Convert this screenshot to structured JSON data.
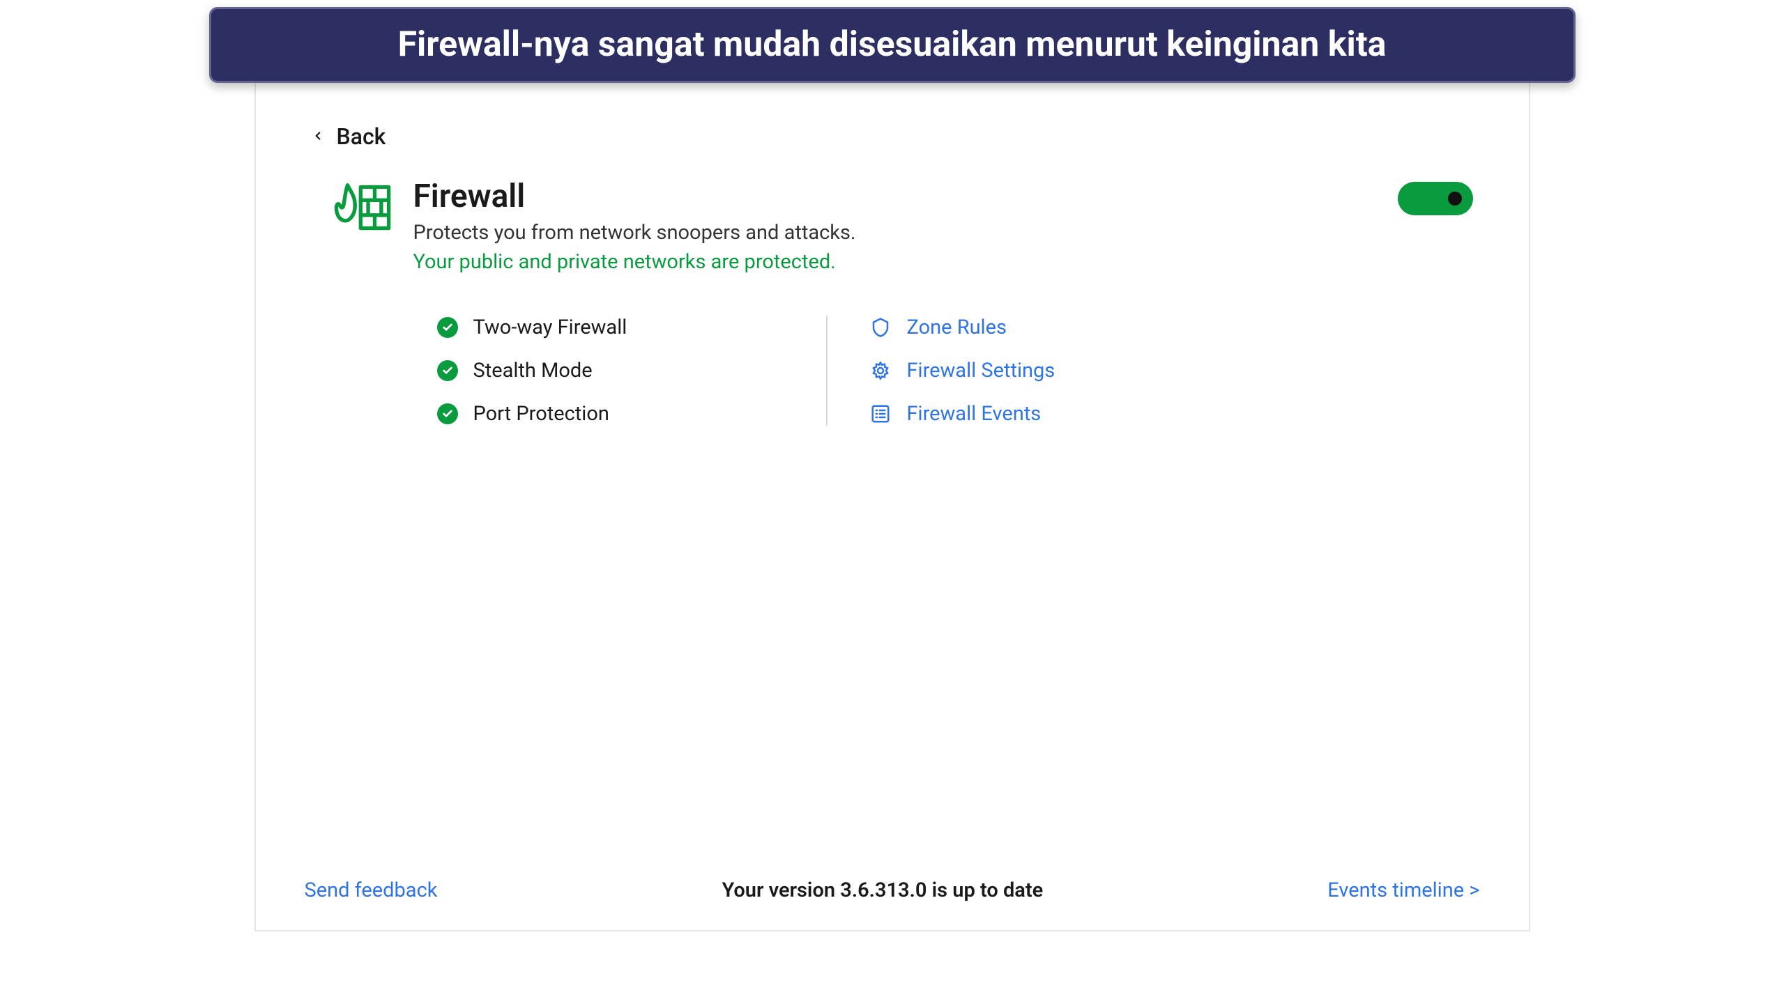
{
  "banner": {
    "text": "Firewall-nya sangat mudah disesuaikan menurut keinginan kita"
  },
  "nav": {
    "back_label": "Back"
  },
  "header": {
    "title": "Firewall",
    "description": "Protects you from network snoopers and attacks.",
    "status": "Your public and private networks are protected.",
    "toggle_on": true
  },
  "features": [
    {
      "label": "Two-way Firewall"
    },
    {
      "label": "Stealth Mode"
    },
    {
      "label": "Port Protection"
    }
  ],
  "links": [
    {
      "label": "Zone Rules",
      "icon": "shield"
    },
    {
      "label": "Firewall Settings",
      "icon": "gear"
    },
    {
      "label": "Firewall Events",
      "icon": "list"
    }
  ],
  "footer": {
    "feedback": "Send feedback",
    "version": "Your version 3.6.313.0 is up to date",
    "timeline": "Events timeline >"
  },
  "colors": {
    "green": "#0a9b3e",
    "link_blue": "#2f74e7",
    "banner_bg": "#2d2f63"
  }
}
